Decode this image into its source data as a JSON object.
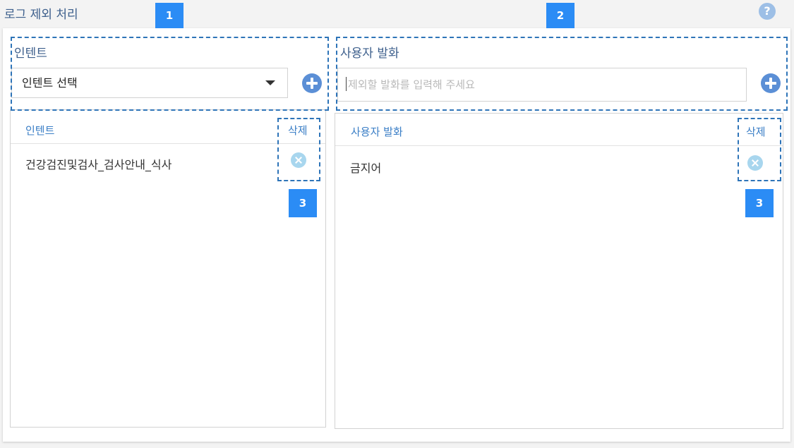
{
  "page": {
    "title": "로그 제외 처리",
    "help_icon": "?"
  },
  "callouts": {
    "one": "1",
    "two": "2",
    "three_left": "3",
    "three_right": "3"
  },
  "intent_section": {
    "label": "인텐트",
    "select_value": "인텐트 선택",
    "add_icon": "plus-circle-icon",
    "table": {
      "col_name": "인텐트",
      "col_delete": "삭제",
      "rows": [
        {
          "name": "건강검진및검사_검사안내_식사",
          "delete_icon": "x-circle-icon"
        }
      ]
    }
  },
  "utterance_section": {
    "label": "사용자 발화",
    "input_value": "",
    "input_placeholder": "제외할 발화를 입력해 주세요",
    "add_icon": "plus-circle-icon",
    "table": {
      "col_name": "사용자 발화",
      "col_delete": "삭제",
      "rows": [
        {
          "name": "금지어",
          "delete_icon": "x-circle-icon"
        }
      ]
    }
  },
  "colors": {
    "accent": "#2b8cf5",
    "title": "#3d5f8c",
    "header": "#3a7ec6",
    "dashed": "#2e74b8",
    "add_button": "#5b8fd6",
    "delete_button": "#a8d6ee"
  }
}
